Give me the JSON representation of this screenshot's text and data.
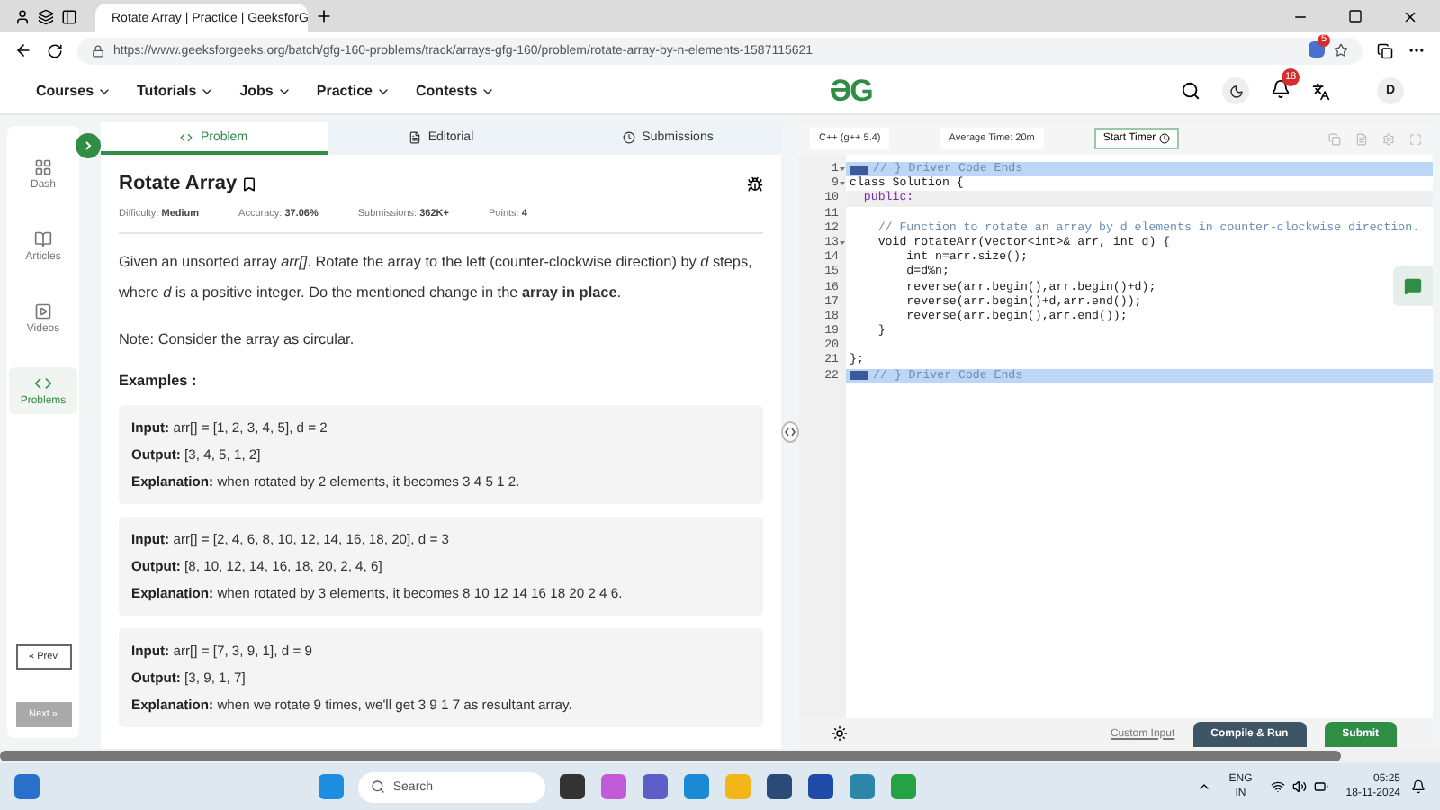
{
  "browser": {
    "tab_title": "Rotate Array | Practice | GeeksforG",
    "url": "https://www.geeksforgeeks.org/batch/gfg-160-problems/track/arrays-gfg-160/problem/rotate-array-by-n-elements-1587115621",
    "extension_badge": "5"
  },
  "site_nav": {
    "menus": [
      "Courses",
      "Tutorials",
      "Jobs",
      "Practice",
      "Contests"
    ],
    "logo": "ƏG",
    "notification_count": "18",
    "avatar": "D"
  },
  "sidebar": {
    "items": [
      {
        "label": "Dash",
        "selected": false
      },
      {
        "label": "Articles",
        "selected": false
      },
      {
        "label": "Videos",
        "selected": false
      },
      {
        "label": "Problems",
        "selected": true
      }
    ],
    "prev": "« Prev",
    "next": "Next »"
  },
  "problem_tabs": [
    {
      "label": "Problem",
      "selected": true
    },
    {
      "label": "Editorial",
      "selected": false
    },
    {
      "label": "Submissions",
      "selected": false
    }
  ],
  "problem": {
    "title": "Rotate Array",
    "meta": [
      {
        "label": "Difficulty:",
        "value": "Medium"
      },
      {
        "label": "Accuracy:",
        "value": "37.06%"
      },
      {
        "label": "Submissions:",
        "value": "362K+"
      },
      {
        "label": "Points:",
        "value": "4"
      }
    ],
    "description": "Given an unsorted array *arr[]*. Rotate the array to the left (counter-clockwise direction) by *d* steps, where *d* is a positive integer. Do the mentioned change in the **array in place**.",
    "note": "Note: Consider the array as circular.",
    "examples_heading": "Examples :",
    "examples": [
      [
        {
          "label": "Input:",
          "value": "arr[] = [1, 2, 3, 4, 5], d = 2"
        },
        {
          "label": "Output:",
          "value": "[3, 4, 5, 1, 2]"
        },
        {
          "label": "Explanation:",
          "value": "when rotated by 2 elements, it becomes 3 4 5 1 2."
        }
      ],
      [
        {
          "label": "Input:",
          "value": "arr[] = [2, 4, 6, 8, 10, 12, 14, 16, 18, 20], d = 3"
        },
        {
          "label": "Output:",
          "value": "[8, 10, 12, 14, 16, 18, 20, 2, 4, 6]"
        },
        {
          "label": "Explanation:",
          "value": "when rotated by 3 elements, it becomes 8 10 12 14 16 18 20 2 4 6."
        }
      ],
      [
        {
          "label": "Input:",
          "value": "arr[] = [7, 3, 9, 1], d = 9"
        },
        {
          "label": "Output:",
          "value": "[3, 9, 1, 7]"
        },
        {
          "label": "Explanation:",
          "value": "when we rotate 9 times, we'll get 3 9 1 7 as resultant array."
        }
      ]
    ]
  },
  "editor": {
    "language": "C++ (g++ 5.4)",
    "average_time": "Average Time: 20m",
    "timer": "Start Timer",
    "lines": [
      {
        "number": "1",
        "text": "// } Driver Code Ends",
        "kind": "comment",
        "fold": true,
        "highlighted": true,
        "active": false
      },
      {
        "number": "9",
        "text": "class Solution {",
        "kind": "code",
        "fold": true,
        "highlighted": false,
        "active": false
      },
      {
        "number": "10",
        "text": "  public:",
        "kind": "keyword",
        "fold": false,
        "highlighted": false,
        "active": true
      },
      {
        "number": "11",
        "fold": false,
        "highlighted": false,
        "active": false
      },
      {
        "number": "12",
        "text": "    // Function to rotate an array by d elements in counter-clockwise direction.",
        "kind": "comment",
        "fold": false,
        "highlighted": false,
        "active": false
      },
      {
        "number": "13",
        "text": "    void rotateArr(vector<int>& arr, int d) {",
        "kind": "code",
        "fold": true,
        "highlighted": false,
        "active": false
      },
      {
        "number": "14",
        "text": "        int n=arr.size();",
        "kind": "code",
        "fold": false,
        "highlighted": false,
        "active": false
      },
      {
        "number": "15",
        "text": "        d=d%n;",
        "kind": "code",
        "fold": false,
        "highlighted": false,
        "active": false
      },
      {
        "number": "16",
        "text": "        reverse(arr.begin(),arr.begin()+d);",
        "kind": "code",
        "fold": false,
        "highlighted": false,
        "active": false
      },
      {
        "number": "17",
        "text": "        reverse(arr.begin()+d,arr.end());",
        "kind": "code",
        "fold": false,
        "highlighted": false,
        "active": false
      },
      {
        "number": "18",
        "text": "        reverse(arr.begin(),arr.end());",
        "kind": "code",
        "fold": false,
        "highlighted": false,
        "active": false
      },
      {
        "number": "19",
        "text": "    }",
        "kind": "code",
        "fold": false,
        "highlighted": false,
        "active": false
      },
      {
        "number": "20",
        "fold": false,
        "highlighted": false,
        "active": false
      },
      {
        "number": "21",
        "text": "};",
        "kind": "code",
        "fold": false,
        "highlighted": false,
        "active": false
      },
      {
        "number": "22",
        "text": "// } Driver Code Ends",
        "kind": "comment",
        "fold": false,
        "highlighted": true,
        "active": false
      }
    ],
    "custom_input": "Custom Input",
    "compile": "Compile & Run",
    "submit": "Submit"
  },
  "taskbar": {
    "search": "Search",
    "language": "ENG",
    "region": "IN",
    "time": "05:25",
    "date": "18-11-2024"
  }
}
